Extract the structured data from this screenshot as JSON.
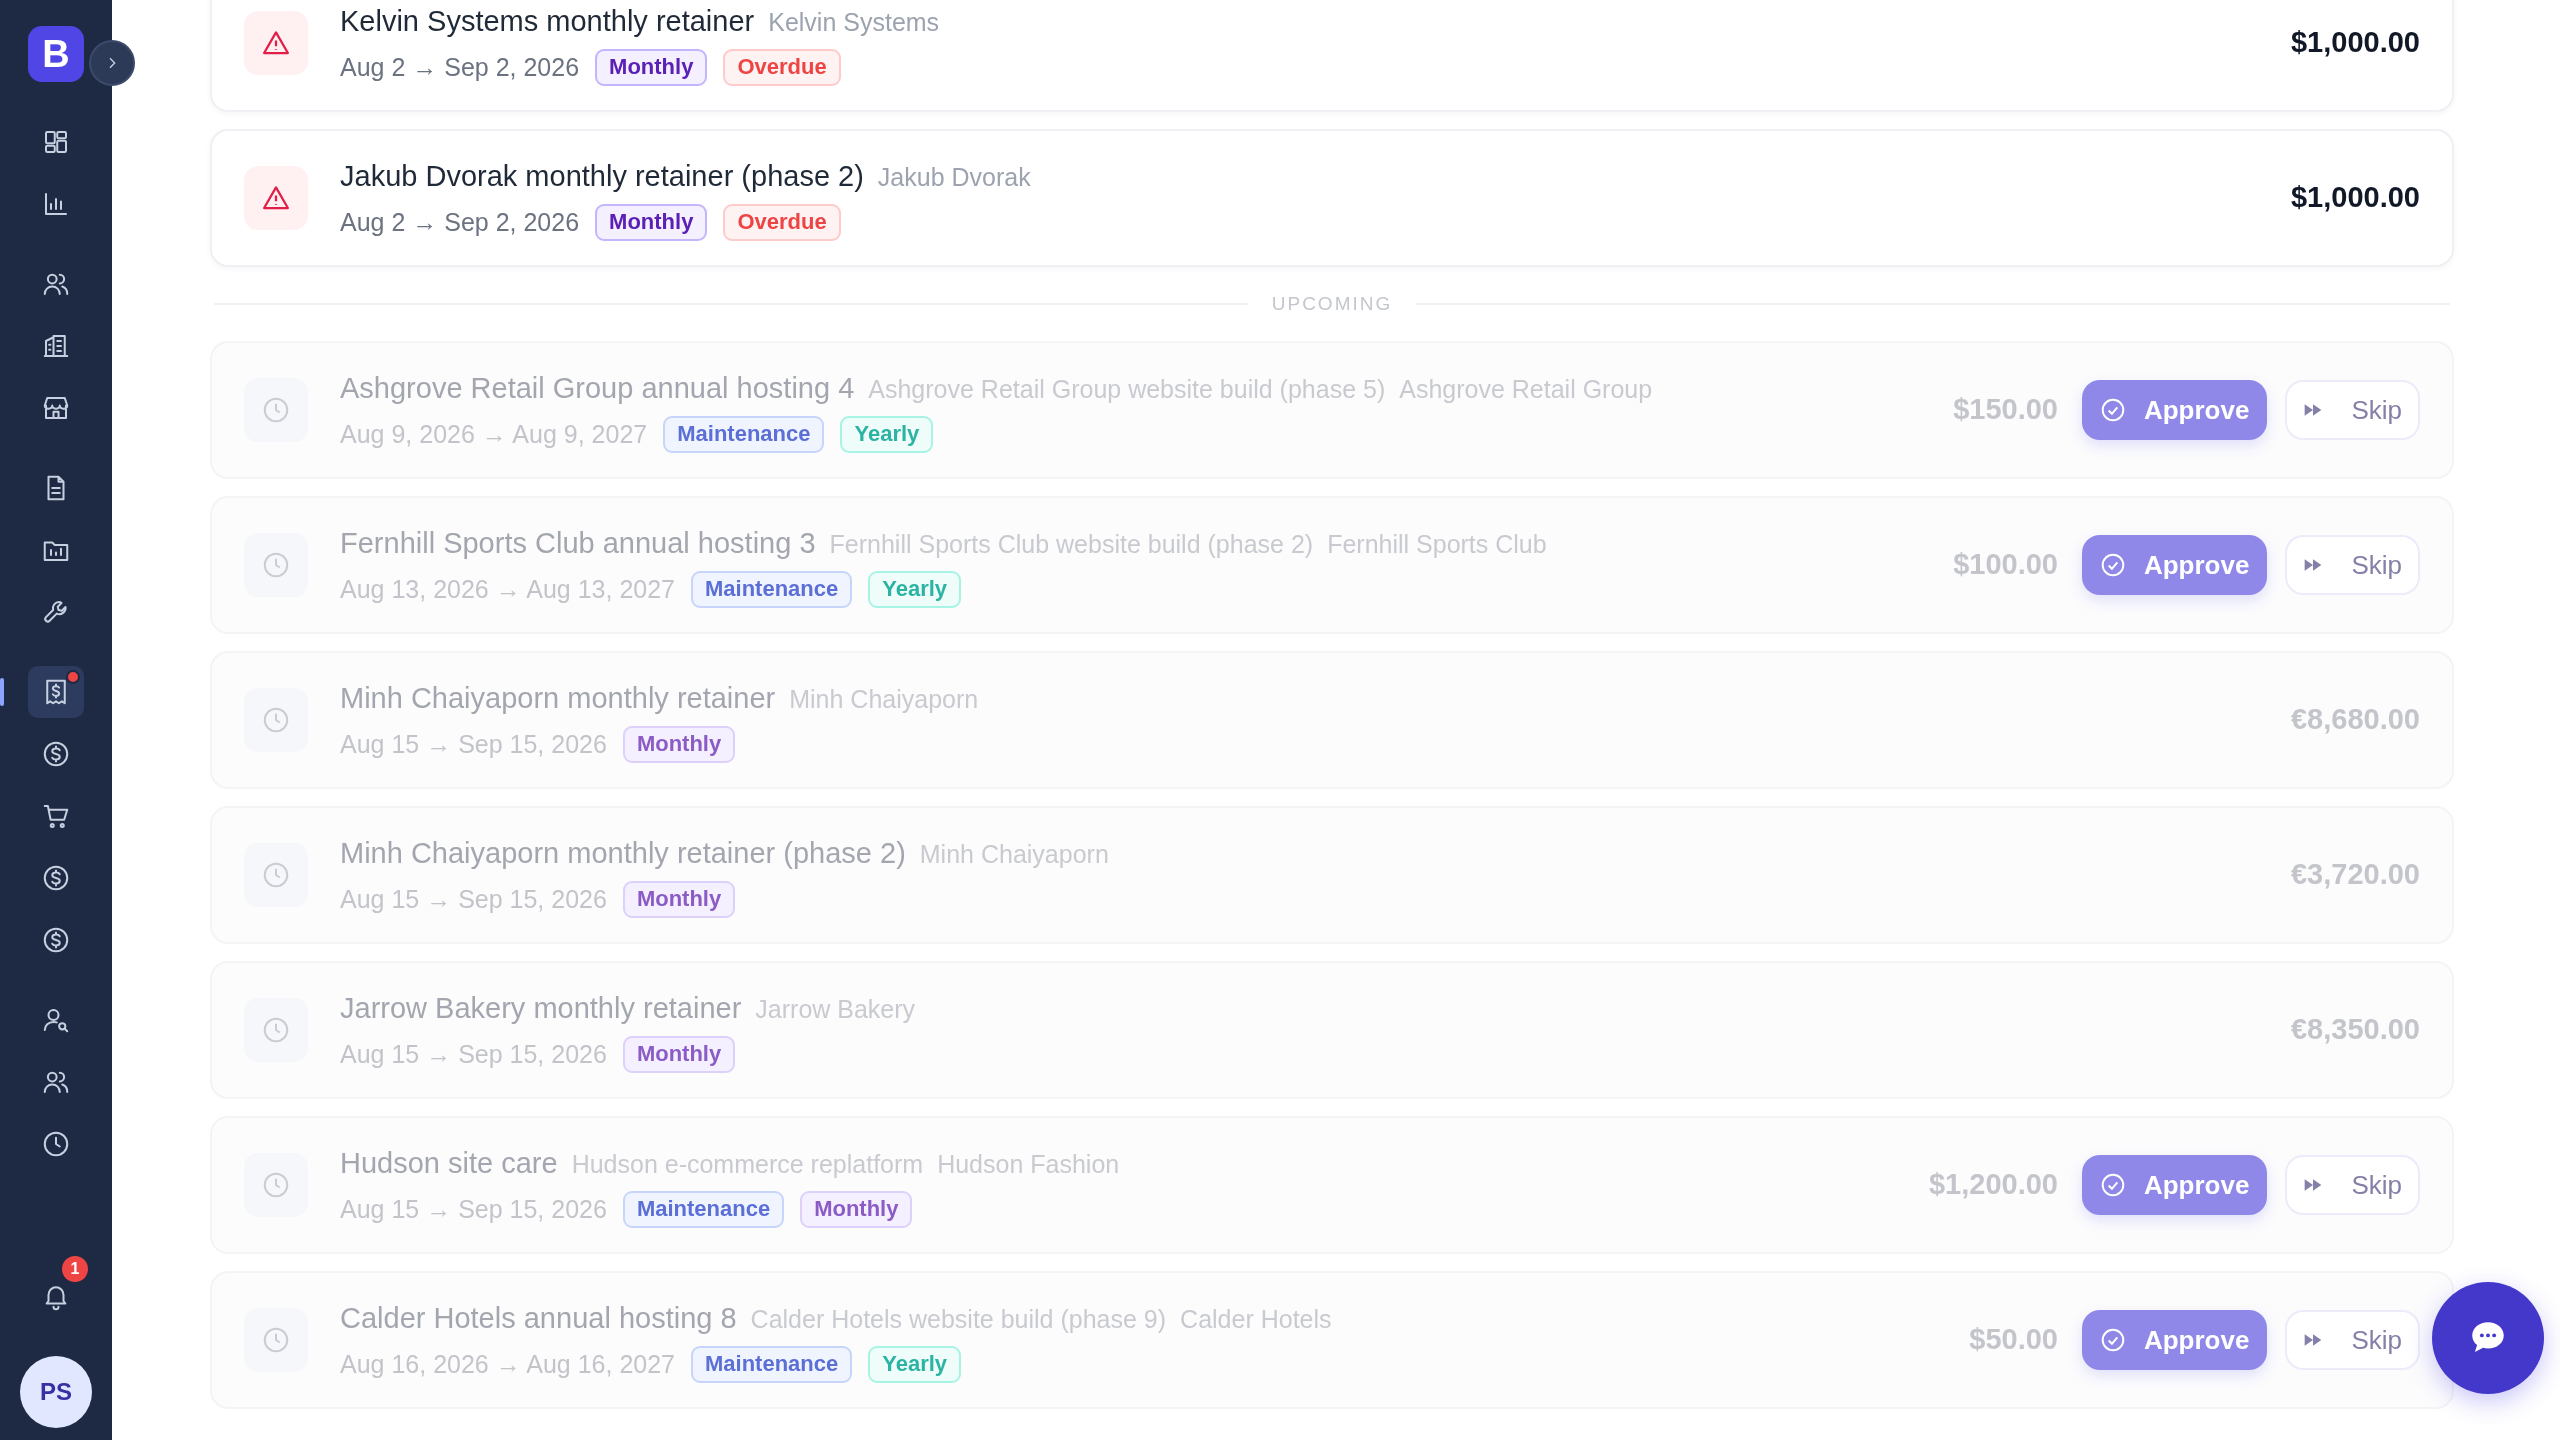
{
  "sidebar": {
    "logo": "B",
    "groups": [
      [
        {
          "kind": "grid",
          "selected": false,
          "dot": false
        },
        {
          "kind": "chart",
          "selected": false,
          "dot": false
        }
      ],
      [
        {
          "kind": "users",
          "selected": false,
          "dot": false
        },
        {
          "kind": "building",
          "selected": false,
          "dot": false
        },
        {
          "kind": "store",
          "selected": false,
          "dot": false
        }
      ],
      [
        {
          "kind": "doc",
          "selected": false,
          "dot": false
        },
        {
          "kind": "folder",
          "selected": false,
          "dot": false
        },
        {
          "kind": "wrench",
          "selected": false,
          "dot": false
        }
      ],
      [
        {
          "kind": "receipt",
          "selected": true,
          "dot": true
        },
        {
          "kind": "dollar",
          "selected": false,
          "dot": false
        },
        {
          "kind": "cart",
          "selected": false,
          "dot": false
        },
        {
          "kind": "dollar",
          "selected": false,
          "dot": false
        },
        {
          "kind": "dollar",
          "selected": false,
          "dot": false
        }
      ],
      [
        {
          "kind": "usersearch",
          "selected": false,
          "dot": false
        },
        {
          "kind": "users",
          "selected": false,
          "dot": false
        },
        {
          "kind": "clock",
          "selected": false,
          "dot": false
        }
      ]
    ],
    "notifications": "1",
    "avatar": "PS"
  },
  "rows": [
    {
      "kind": "overdue",
      "title": "Kelvin Systems monthly retainer",
      "refs": [
        "Kelvin Systems"
      ],
      "dates": "Aug 2 → Sep 2, 2026",
      "tags": [
        {
          "label": "Monthly",
          "kind": "monthly"
        },
        {
          "label": "Overdue",
          "kind": "overdue"
        }
      ],
      "amount": "$1,000.00",
      "buttons": []
    },
    {
      "kind": "overdue",
      "title": "Jakub Dvorak monthly retainer (phase 2)",
      "refs": [
        "Jakub Dvorak"
      ],
      "dates": "Aug 2 → Sep 2, 2026",
      "tags": [
        {
          "label": "Monthly",
          "kind": "monthly"
        },
        {
          "label": "Overdue",
          "kind": "overdue"
        }
      ],
      "amount": "$1,000.00",
      "buttons": []
    },
    {
      "kind": "divider",
      "label": "UPCOMING"
    },
    {
      "kind": "upcoming",
      "title": "Ashgrove Retail Group annual hosting 4",
      "refs": [
        "Ashgrove Retail Group website build (phase 5)",
        "Ashgrove Retail Group"
      ],
      "dates": "Aug 9, 2026 → Aug 9, 2027",
      "tags": [
        {
          "label": "Maintenance",
          "kind": "maintenance"
        },
        {
          "label": "Yearly",
          "kind": "yearly"
        }
      ],
      "amount": "$150.00",
      "buttons": [
        {
          "label": "Approve",
          "kind": "approve"
        },
        {
          "label": "Skip",
          "kind": "skip"
        }
      ]
    },
    {
      "kind": "upcoming",
      "title": "Fernhill Sports Club annual hosting 3",
      "refs": [
        "Fernhill Sports Club website build (phase 2)",
        "Fernhill Sports Club"
      ],
      "dates": "Aug 13, 2026 → Aug 13, 2027",
      "tags": [
        {
          "label": "Maintenance",
          "kind": "maintenance"
        },
        {
          "label": "Yearly",
          "kind": "yearly"
        }
      ],
      "amount": "$100.00",
      "buttons": [
        {
          "label": "Approve",
          "kind": "approve"
        },
        {
          "label": "Skip",
          "kind": "skip"
        }
      ]
    },
    {
      "kind": "upcoming",
      "title": "Minh Chaiyaporn monthly retainer",
      "refs": [
        "Minh Chaiyaporn"
      ],
      "dates": "Aug 15 → Sep 15, 2026",
      "tags": [
        {
          "label": "Monthly",
          "kind": "monthly"
        }
      ],
      "amount": "€8,680.00",
      "buttons": []
    },
    {
      "kind": "upcoming",
      "title": "Minh Chaiyaporn monthly retainer (phase 2)",
      "refs": [
        "Minh Chaiyaporn"
      ],
      "dates": "Aug 15 → Sep 15, 2026",
      "tags": [
        {
          "label": "Monthly",
          "kind": "monthly"
        }
      ],
      "amount": "€3,720.00",
      "buttons": []
    },
    {
      "kind": "upcoming",
      "title": "Jarrow Bakery monthly retainer",
      "refs": [
        "Jarrow Bakery"
      ],
      "dates": "Aug 15 → Sep 15, 2026",
      "tags": [
        {
          "label": "Monthly",
          "kind": "monthly"
        }
      ],
      "amount": "€8,350.00",
      "buttons": []
    },
    {
      "kind": "upcoming",
      "title": "Hudson site care",
      "refs": [
        "Hudson e-commerce replatform",
        "Hudson Fashion"
      ],
      "dates": "Aug 15 → Sep 15, 2026",
      "tags": [
        {
          "label": "Maintenance",
          "kind": "maintenance"
        },
        {
          "label": "Monthly",
          "kind": "monthly"
        }
      ],
      "amount": "$1,200.00",
      "buttons": [
        {
          "label": "Approve",
          "kind": "approve"
        },
        {
          "label": "Skip",
          "kind": "skip"
        }
      ]
    },
    {
      "kind": "upcoming",
      "title": "Calder Hotels annual hosting 8",
      "refs": [
        "Calder Hotels website build (phase 9)",
        "Calder Hotels"
      ],
      "dates": "Aug 16, 2026 → Aug 16, 2027",
      "tags": [
        {
          "label": "Maintenance",
          "kind": "maintenance"
        },
        {
          "label": "Yearly",
          "kind": "yearly"
        }
      ],
      "amount": "$50.00",
      "buttons": [
        {
          "label": "Approve",
          "kind": "approve"
        },
        {
          "label": "Skip",
          "kind": "skip"
        }
      ]
    }
  ]
}
